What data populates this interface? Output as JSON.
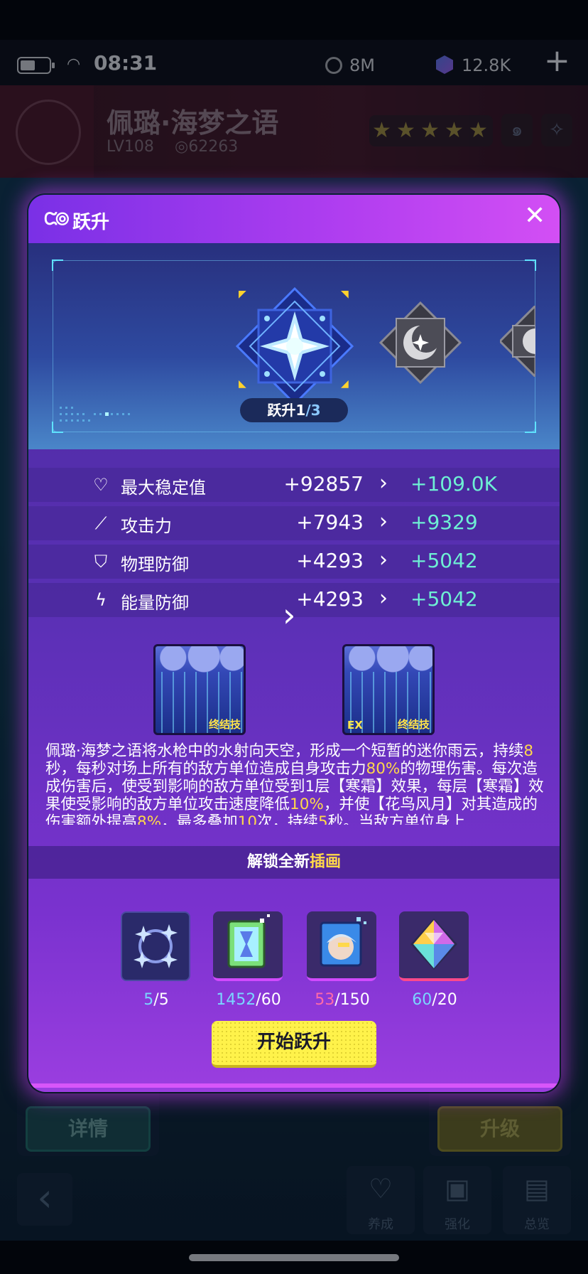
{
  "status_bar": {
    "time": "08:31",
    "resource_1": "8M",
    "resource_2": "12.8K",
    "plus_label": "+"
  },
  "hero": {
    "name": "佩璐·海梦之语",
    "level": "LV108",
    "power": "62263",
    "stars": 5,
    "star_color": "#a08a3a"
  },
  "background": {
    "details_label": "详情",
    "upgrade_label": "升级",
    "back_label": "‹",
    "tabs": [
      {
        "label": "养成",
        "icon": "heart-icon"
      },
      {
        "label": "强化",
        "icon": "chip-icon"
      },
      {
        "label": "总览",
        "icon": "folder-icon"
      }
    ]
  },
  "modal": {
    "title": "跃升",
    "close_label": "✕",
    "rank_current": "跃升1",
    "rank_max": "/3",
    "stats": [
      {
        "icon": "heart-icon",
        "label": "最大稳定值",
        "old": "+92857",
        "new": "+109.0K"
      },
      {
        "icon": "sword-icon",
        "label": "攻击力",
        "old": "+7943",
        "new": "+9329"
      },
      {
        "icon": "shield-icon",
        "label": "物理防御",
        "old": "+4293",
        "new": "+5042"
      },
      {
        "icon": "energy-shield-icon",
        "label": "能量防御",
        "old": "+4293",
        "new": "+5042"
      }
    ],
    "skill_before_tag": "终结技",
    "skill_after_ex": "EX",
    "skill_after_tag": "终结技",
    "description": [
      {
        "t": "佩璐·海梦之语将水枪中的水射向天空，形成一个短暂的迷你雨云，持续",
        "h": false
      },
      {
        "t": "8",
        "h": true
      },
      {
        "t": "秒，每秒对场上所有的敌方单位造成自身攻击力",
        "h": false
      },
      {
        "t": "80%",
        "h": true
      },
      {
        "t": "的物理伤害。每次造成伤害后，使受到影响的敌方单位受到1层【寒霜】效果，每层【寒霜】效果使受影响的敌方单位攻击速度降低",
        "h": false
      },
      {
        "t": "10%",
        "h": true
      },
      {
        "t": "，并使【花鸟风月】对其造成的伤害额外提高",
        "h": false
      },
      {
        "t": "8%",
        "h": true
      },
      {
        "t": "，最多叠加",
        "h": false
      },
      {
        "t": "10",
        "h": true
      },
      {
        "t": "次，持续",
        "h": false
      },
      {
        "t": "5",
        "h": true
      },
      {
        "t": "秒。当敌方单位身上",
        "h": false
      }
    ],
    "unlock_prefix": "解锁全新",
    "unlock_highlight": "插画",
    "materials": [
      {
        "icon": "star-cluster-icon",
        "have": "5",
        "need": "/5",
        "have_color": "#7ad6ff"
      },
      {
        "icon": "data-card-icon",
        "have": "1452",
        "need": "/60",
        "have_color": "#7ad6ff"
      },
      {
        "icon": "character-card-icon",
        "have": "53",
        "need": "/150",
        "have_color": "#ff6aa8"
      },
      {
        "icon": "prism-icon",
        "have": "60",
        "need": "/20",
        "have_color": "#7ad6ff"
      }
    ],
    "start_label": "开始跃升"
  }
}
